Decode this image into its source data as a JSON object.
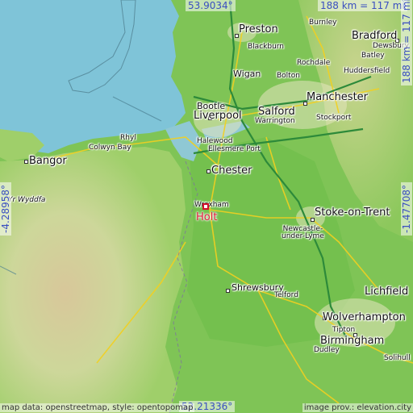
{
  "map": {
    "location": {
      "name": "Holt"
    },
    "coords": {
      "top_lat": "53.9034°",
      "bottom_lat": "52.21336°",
      "left_lon": "-4.28958°",
      "right_lon": "-1.47708°"
    },
    "scale": {
      "horizontal": "188 km = 117 mi",
      "vertical": "188 km = 117 mi"
    },
    "attribution": {
      "left": "map data: openstreetmap, style: opentopomap",
      "right": "image prov.: elevation.city"
    },
    "cities": {
      "preston": "Preston",
      "burnley": "Burnley",
      "bradford": "Bradford",
      "blackburn": "Blackburn",
      "dewsbury": "Dewsbury",
      "batley": "Batley",
      "rochdale": "Rochdale",
      "huddersfield": "Huddersfield",
      "wigan": "Wigan",
      "bolton": "Bolton",
      "bootle": "Bootle",
      "salford": "Salford",
      "manchester": "Manchester",
      "liverpool": "Liverpool",
      "warrington": "Warrington",
      "stockport": "Stockport",
      "halewood": "Halewood",
      "ellesmere_port": "Ellesmere Port",
      "rhyl": "Rhyl",
      "colwyn_bay": "Colwyn Bay",
      "bangor": "Bangor",
      "chester": "Chester",
      "wrexham": "Wrexham",
      "stoke": "Stoke-on-Trent",
      "newcastle": "Newcastle-\nunder-Lyme",
      "yr_wyddfa": "Yr Wyddfa",
      "shrewsbury": "Shrewsbury",
      "telford": "Telford",
      "lichfield": "Lichfield",
      "wolverhampton": "Wolverhampton",
      "tipton": "Tipton",
      "birmingham": "Birmingham",
      "dudley": "Dudley",
      "solihull": "Solihull"
    }
  }
}
